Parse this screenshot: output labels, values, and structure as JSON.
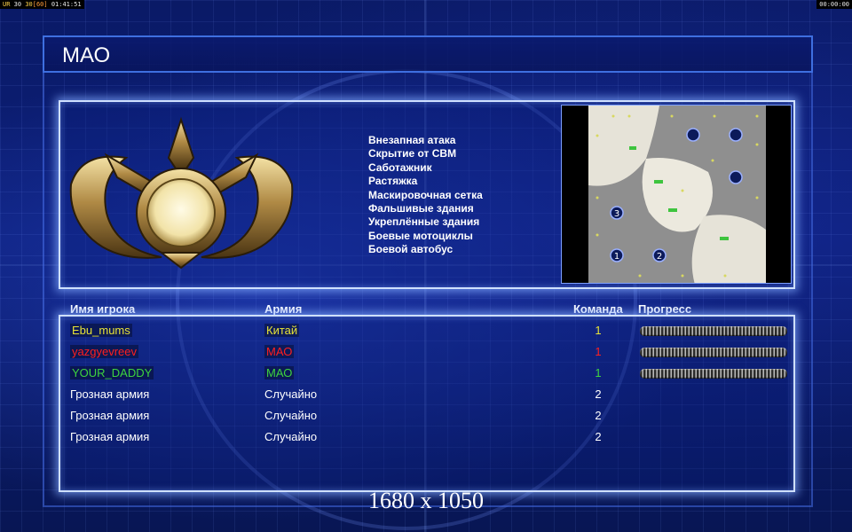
{
  "hud": {
    "tag1": "UR",
    "fps": "30",
    "fps2": "30",
    "fps3": "[60]",
    "clock": "01:41:51",
    "timer": "00:00:00"
  },
  "title": "МАО",
  "faction_emblem": "china-emblem",
  "generals_powers": [
    "Внезапная атака",
    "Скрытие от СВМ",
    "Саботажник",
    "Растяжка",
    "Маскировочная сетка",
    "Фальшивые здания",
    "Укреплённые здания",
    "Боевые мотоциклы",
    "Боевой автобус"
  ],
  "map": {
    "start_positions": [
      "3",
      "1",
      "2"
    ]
  },
  "headers": {
    "player_name": "Имя игрока",
    "army": "Армия",
    "team": "Команда",
    "progress": "Прогресс"
  },
  "players": [
    {
      "name": "Ebu_mums",
      "army": "Китай",
      "team": "1",
      "color": "#e8e336",
      "progress": 1.0
    },
    {
      "name": "yazgyevreev",
      "army": "МАО",
      "team": "1",
      "color": "#ff1f1f",
      "progress": 1.0
    },
    {
      "name": "YOUR_DADDY",
      "army": "МАО",
      "team": "1",
      "color": "#3ed43e",
      "progress": 1.0
    },
    {
      "name": "Грозная армия",
      "army": "Случайно",
      "team": "2",
      "color": "#ffffff"
    },
    {
      "name": "Грозная армия",
      "army": "Случайно",
      "team": "2",
      "color": "#ffffff"
    },
    {
      "name": "Грозная армия",
      "army": "Случайно",
      "team": "2",
      "color": "#ffffff"
    }
  ],
  "resolution": "1680 x 1050",
  "colors": {
    "frame_glow": "#cfe0ff",
    "panel_border": "#3e6fe0"
  }
}
